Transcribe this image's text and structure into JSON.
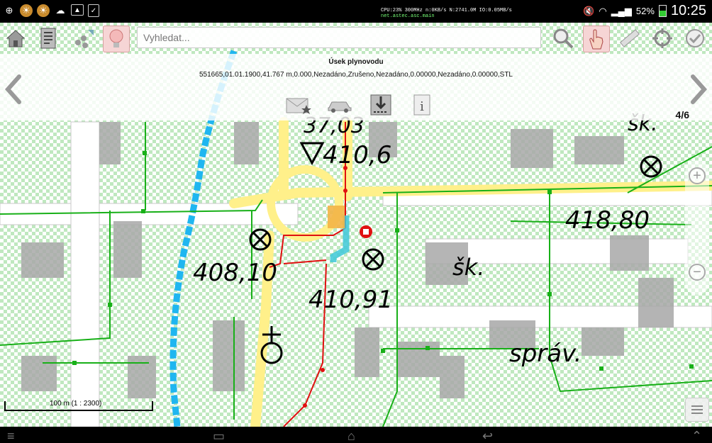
{
  "status_bar": {
    "stats_line1": "CPU:23% 300MHz n:0KB/s N:2741.0M IO:0.05MB/s",
    "stats_line2": "net.astec.asc.main",
    "battery": "52%",
    "time": "10:25",
    "icons": [
      "gps-icon",
      "weather-icon",
      "weather-icon",
      "cloud-icon",
      "image-icon",
      "clipboard-icon",
      "mute-icon",
      "wifi-icon",
      "signal-icon",
      "battery-icon"
    ]
  },
  "toolbar": {
    "search_placeholder": "Vyhledat...",
    "left_buttons": [
      "home-icon",
      "document-icon",
      "layers-icon",
      "bulb-icon"
    ],
    "right_buttons": [
      "zoom-icon",
      "hand-icon",
      "ruler-icon",
      "crosshair-icon",
      "check-icon"
    ]
  },
  "info_panel": {
    "title": "Úsek plynovodu",
    "value": "551665,01.01.1900,41.767 m,0.000,Nezadáno,Zrušeno,Nezadáno,0.00000,Nezadáno,0.00000,STL",
    "counter": "4/6",
    "actions": [
      "mail-star-icon",
      "car-icon",
      "route-icon",
      "info-icon"
    ]
  },
  "map": {
    "labels": [
      "37,03",
      "410,6",
      "418,80",
      "408,10",
      "šk.",
      "410,91",
      "správ.",
      "šk."
    ],
    "scale": "100 m (1 : 2300)"
  },
  "colors": {
    "gas_line_red": "#e01010",
    "utility_green": "#18b018",
    "road_yellow": "#fff08a",
    "river_blue": "#1fb6f0",
    "selection_cyan": "#3ec8d8"
  }
}
